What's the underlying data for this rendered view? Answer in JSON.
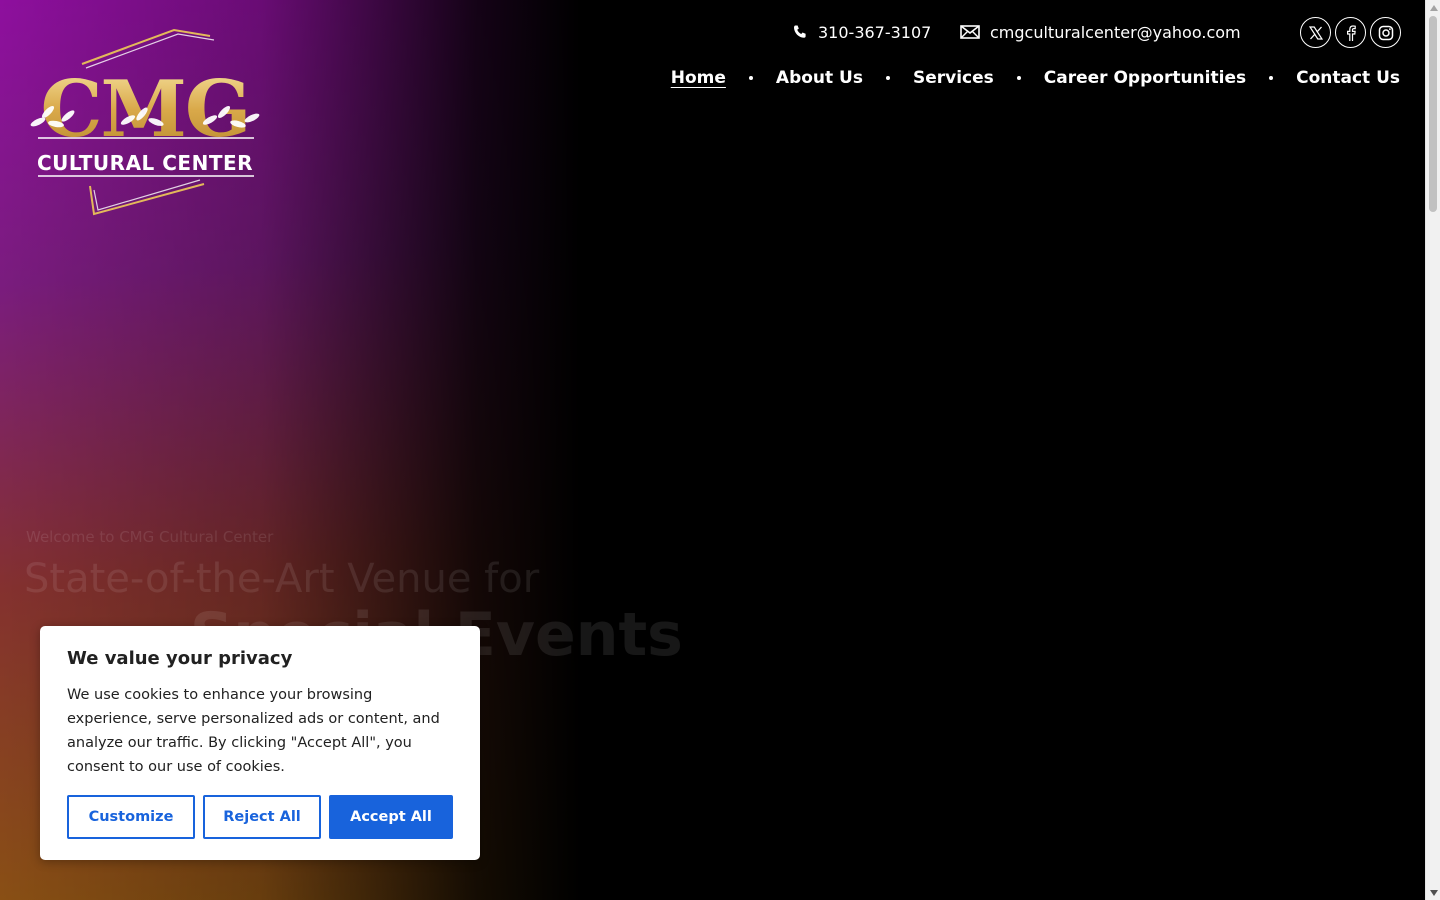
{
  "logo": {
    "letters": "CMG",
    "subtitle": "CULTURAL CENTER"
  },
  "contact": {
    "phone": "310-367-3107",
    "email": "cmgculturalcenter@yahoo.com"
  },
  "social": [
    "x-icon",
    "facebook-icon",
    "instagram-icon"
  ],
  "nav": {
    "items": [
      "Home",
      "About Us",
      "Services",
      "Career Opportunities",
      "Contact Us"
    ],
    "active": "Home"
  },
  "hero": {
    "eyebrow": "Welcome to CMG Cultural Center",
    "title": "State-of-the-Art Venue for",
    "title_highlight": "Special Events"
  },
  "cookie_banner": {
    "title": "We value your privacy",
    "text": "We use cookies to enhance your browsing experience, serve personalized ads or content, and analyze our traffic. By clicking \"Accept All\", you consent to our use of cookies.",
    "customize": "Customize",
    "reject": "Reject All",
    "accept": "Accept All"
  },
  "colors": {
    "accent": "#1863dc",
    "gold": "#e3b95a",
    "purple": "#8e0f9e"
  }
}
